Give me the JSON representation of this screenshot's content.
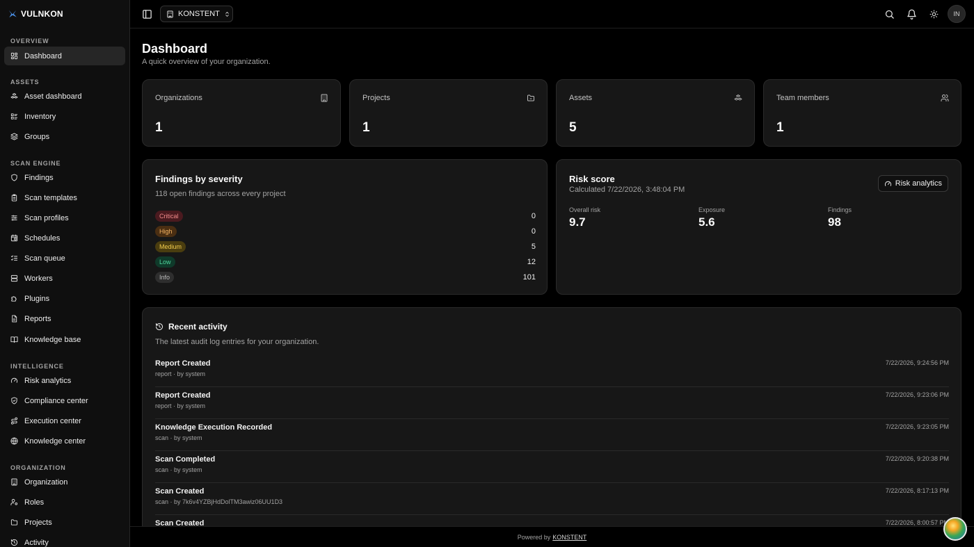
{
  "brand": {
    "name": "VULNKON"
  },
  "sidebar": {
    "sections": [
      {
        "title": "OVERVIEW",
        "items": [
          {
            "label": "Dashboard",
            "icon": "grid-icon",
            "active": true
          }
        ]
      },
      {
        "title": "ASSETS",
        "items": [
          {
            "label": "Asset dashboard",
            "icon": "boxes-icon"
          },
          {
            "label": "Inventory",
            "icon": "list-icon"
          },
          {
            "label": "Groups",
            "icon": "layers-icon"
          }
        ]
      },
      {
        "title": "SCAN ENGINE",
        "items": [
          {
            "label": "Findings",
            "icon": "shield-icon"
          },
          {
            "label": "Scan templates",
            "icon": "clipboard-icon"
          },
          {
            "label": "Scan profiles",
            "icon": "sliders-icon"
          },
          {
            "label": "Schedules",
            "icon": "calendar-clock-icon"
          },
          {
            "label": "Scan queue",
            "icon": "list-checks-icon"
          },
          {
            "label": "Workers",
            "icon": "server-icon"
          },
          {
            "label": "Plugins",
            "icon": "puzzle-icon"
          },
          {
            "label": "Reports",
            "icon": "file-icon"
          },
          {
            "label": "Knowledge base",
            "icon": "book-icon"
          }
        ]
      },
      {
        "title": "INTELLIGENCE",
        "items": [
          {
            "label": "Risk analytics",
            "icon": "gauge-icon"
          },
          {
            "label": "Compliance center",
            "icon": "shield-check-icon"
          },
          {
            "label": "Execution center",
            "icon": "route-icon"
          },
          {
            "label": "Knowledge center",
            "icon": "globe-icon"
          }
        ]
      },
      {
        "title": "ORGANIZATION",
        "items": [
          {
            "label": "Organization",
            "icon": "building-icon"
          },
          {
            "label": "Roles",
            "icon": "user-cog-icon"
          },
          {
            "label": "Projects",
            "icon": "folder-icon"
          },
          {
            "label": "Activity",
            "icon": "history-icon"
          }
        ]
      }
    ]
  },
  "topbar": {
    "org": "KONSTENT",
    "avatar": "IN"
  },
  "page": {
    "title": "Dashboard",
    "subtitle": "A quick overview of your organization."
  },
  "stats": [
    {
      "label": "Organizations",
      "value": "1",
      "icon": "building-icon"
    },
    {
      "label": "Projects",
      "value": "1",
      "icon": "folder-icon"
    },
    {
      "label": "Assets",
      "value": "5",
      "icon": "boxes-icon"
    },
    {
      "label": "Team members",
      "value": "1",
      "icon": "users-icon"
    }
  ],
  "findings": {
    "title": "Findings by severity",
    "subtitle": "118 open findings across every project",
    "rows": [
      {
        "label": "Critical",
        "count": "0",
        "bg": "#4a1a1f",
        "fg": "#f28b8b"
      },
      {
        "label": "High",
        "count": "0",
        "bg": "#4a2e12",
        "fg": "#f5b462"
      },
      {
        "label": "Medium",
        "count": "5",
        "bg": "#4a3d0f",
        "fg": "#f2cc4d"
      },
      {
        "label": "Low",
        "count": "12",
        "bg": "#0f3a2a",
        "fg": "#4fd69c"
      },
      {
        "label": "Info",
        "count": "101",
        "bg": "#2e2e2e",
        "fg": "#bdbdbd"
      }
    ]
  },
  "risk": {
    "title": "Risk score",
    "calculated": "Calculated 7/22/2026, 3:48:04 PM",
    "button": "Risk analytics",
    "metrics": [
      {
        "label": "Overall risk",
        "value": "9.7"
      },
      {
        "label": "Exposure",
        "value": "5.6"
      },
      {
        "label": "Findings",
        "value": "98"
      }
    ]
  },
  "activity": {
    "title": "Recent activity",
    "subtitle": "The latest audit log entries for your organization.",
    "rows": [
      {
        "title": "Report Created",
        "meta": "report · by system",
        "time": "7/22/2026, 9:24:56 PM"
      },
      {
        "title": "Report Created",
        "meta": "report · by system",
        "time": "7/22/2026, 9:23:06 PM"
      },
      {
        "title": "Knowledge Execution Recorded",
        "meta": "scan · by system",
        "time": "7/22/2026, 9:23:05 PM"
      },
      {
        "title": "Scan Completed",
        "meta": "scan · by system",
        "time": "7/22/2026, 9:20:38 PM"
      },
      {
        "title": "Scan Created",
        "meta": "scan · by 7k6v4YZBjHdDolTM3awiz06UU1D3",
        "time": "7/22/2026, 8:17:13 PM"
      },
      {
        "title": "Scan Created",
        "meta": "",
        "time": "7/22/2026, 8:00:57 PM"
      }
    ]
  },
  "footer": {
    "prefix": "Powered by",
    "link": "KONSTENT"
  }
}
